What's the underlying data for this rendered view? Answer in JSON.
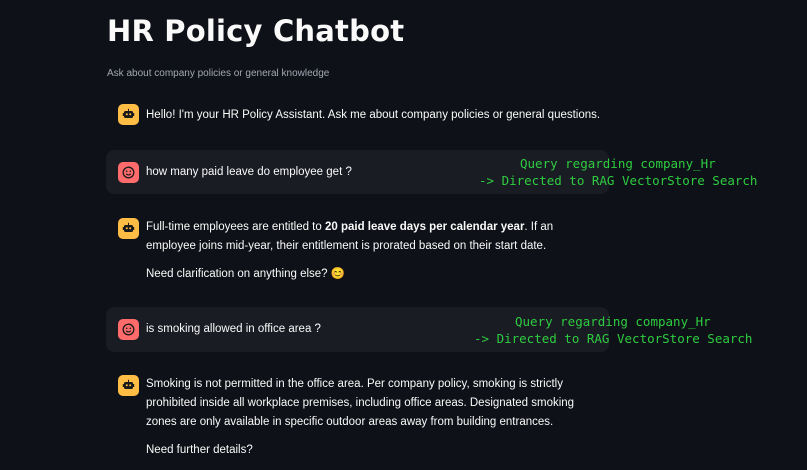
{
  "header": {
    "title": "HR Policy Chatbot",
    "subtitle": "Ask about company policies or general knowledge"
  },
  "messages": [
    {
      "role": "assistant",
      "avatar_icon": "robot-icon",
      "text": "Hello! I'm your HR Policy Assistant. Ask me about company policies or general questions."
    },
    {
      "role": "user",
      "avatar_icon": "smiley-face-icon",
      "text": "how many paid leave do employee get ?"
    },
    {
      "role": "assistant",
      "avatar_icon": "robot-icon",
      "p1_pre": "Full-time employees are entitled to ",
      "p1_bold": "20 paid leave days per calendar year",
      "p1_post": ". If an employee joins mid-year, their entitlement is prorated based on their start date.",
      "p2": "Need clarification on anything else? 😊"
    },
    {
      "role": "user",
      "avatar_icon": "smiley-face-icon",
      "text": "is smoking allowed in office area ?"
    },
    {
      "role": "assistant",
      "avatar_icon": "robot-icon",
      "p1": "Smoking is not permitted in the office area. Per company policy, smoking is strictly prohibited inside all workplace premises, including office areas. Designated smoking zones are only available in specific outdoor areas away from building entrances.",
      "p2": "Need further details?"
    }
  ],
  "annotations": [
    {
      "line1": "Query regarding company_Hr",
      "line2": "-> Directed to RAG VectorStore Search"
    },
    {
      "line1": "Query regarding company_Hr",
      "line2": "-> Directed to RAG VectorStore Search"
    }
  ],
  "colors": {
    "background": "#0e1117",
    "user_bubble": "#1a1c24",
    "assistant_avatar": "#ffbd45",
    "user_avatar": "#ff6b6b",
    "annotation": "#2ecc40"
  }
}
